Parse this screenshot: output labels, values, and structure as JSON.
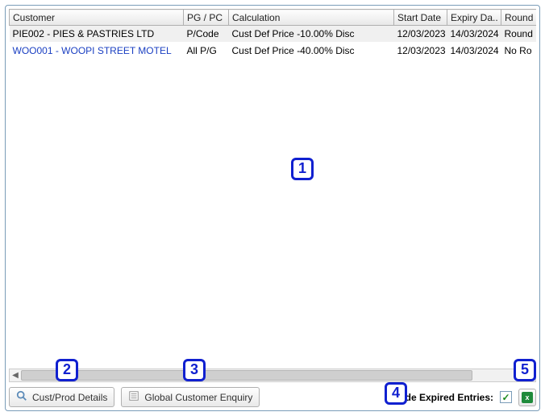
{
  "columns": {
    "customer": "Customer",
    "pgpc": "PG / PC",
    "calculation": "Calculation",
    "start_date": "Start Date",
    "expiry_date": "Expiry Da..",
    "round": "Round"
  },
  "rows": [
    {
      "customer": "PIE002 - PIES & PASTRIES LTD",
      "pgpc": "P/Code",
      "calculation": "Cust Def Price -10.00% Disc",
      "start_date": "12/03/2023",
      "expiry_date": "14/03/2024",
      "round": "Round Neares"
    },
    {
      "customer": "WOO001 - WOOPI STREET MOTEL",
      "pgpc": "All P/G",
      "calculation": "Cust Def Price -40.00% Disc",
      "start_date": "12/03/2023",
      "expiry_date": "14/03/2024",
      "round": "No Ro"
    }
  ],
  "toolbar": {
    "cust_prod_details": "Cust/Prod Details",
    "global_customer_enquiry": "Global Customer Enquiry",
    "hide_expired_label": "Hide Expired Entries:",
    "hide_expired_checked": true
  },
  "annotations": {
    "a1": "1",
    "a2": "2",
    "a3": "3",
    "a4": "4",
    "a5": "5"
  }
}
